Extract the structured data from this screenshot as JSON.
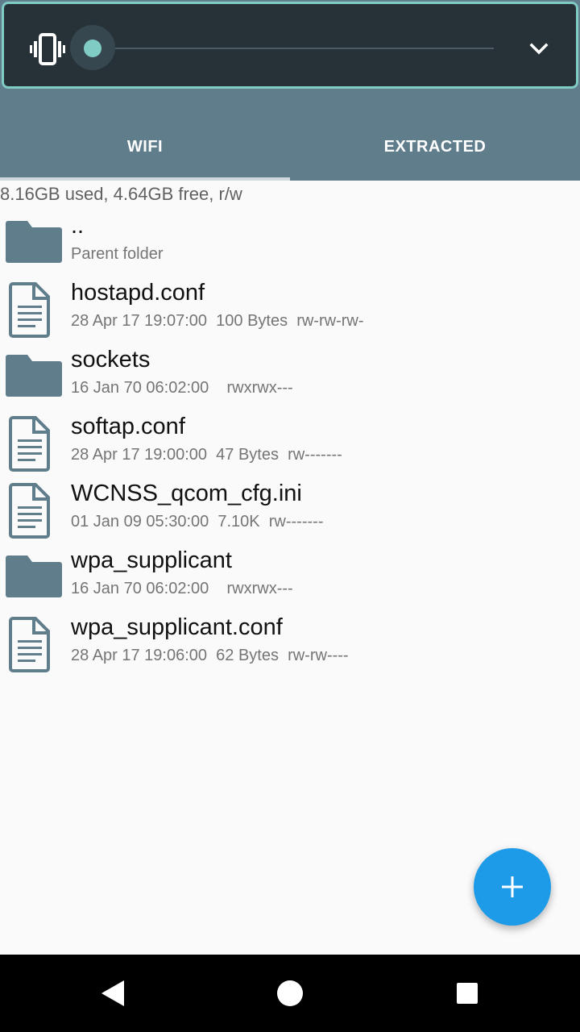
{
  "volume_panel": {
    "ringer_mode_icon": "vibrate-icon",
    "level": 0.0,
    "expand_icon": "chevron-down-icon"
  },
  "tabs": [
    {
      "label": "WIFI",
      "selected": true
    },
    {
      "label": "EXTRACTED",
      "selected": false
    }
  ],
  "storage_info": "8.16GB used, 4.64GB free, r/w",
  "files": [
    {
      "name": "..",
      "meta": "Parent folder",
      "icon": "folder-icon"
    },
    {
      "name": "hostapd.conf",
      "meta": "28 Apr 17 19:07:00  100 Bytes  rw-rw-rw-",
      "icon": "document-icon"
    },
    {
      "name": "sockets",
      "meta": "16 Jan 70 06:02:00    rwxrwx---",
      "icon": "folder-icon"
    },
    {
      "name": "softap.conf",
      "meta": "28 Apr 17 19:00:00  47 Bytes  rw-------",
      "icon": "document-icon"
    },
    {
      "name": "WCNSS_qcom_cfg.ini",
      "meta": "01 Jan 09 05:30:00  7.10K  rw-------",
      "icon": "document-icon"
    },
    {
      "name": "wpa_supplicant",
      "meta": "16 Jan 70 06:02:00    rwxrwx---",
      "icon": "folder-icon"
    },
    {
      "name": "wpa_supplicant.conf",
      "meta": "28 Apr 17 19:06:00  62 Bytes  rw-rw----",
      "icon": "document-icon"
    }
  ],
  "fab": {
    "icon": "plus-icon"
  },
  "navbar": {
    "back": "back-icon",
    "home": "home-icon",
    "recents": "recents-icon"
  },
  "colors": {
    "appbar": "#607d8b",
    "volume_panel": "#263238",
    "accent": "#80cbc4",
    "fab": "#1e9be8",
    "icon": "#607d8b"
  }
}
